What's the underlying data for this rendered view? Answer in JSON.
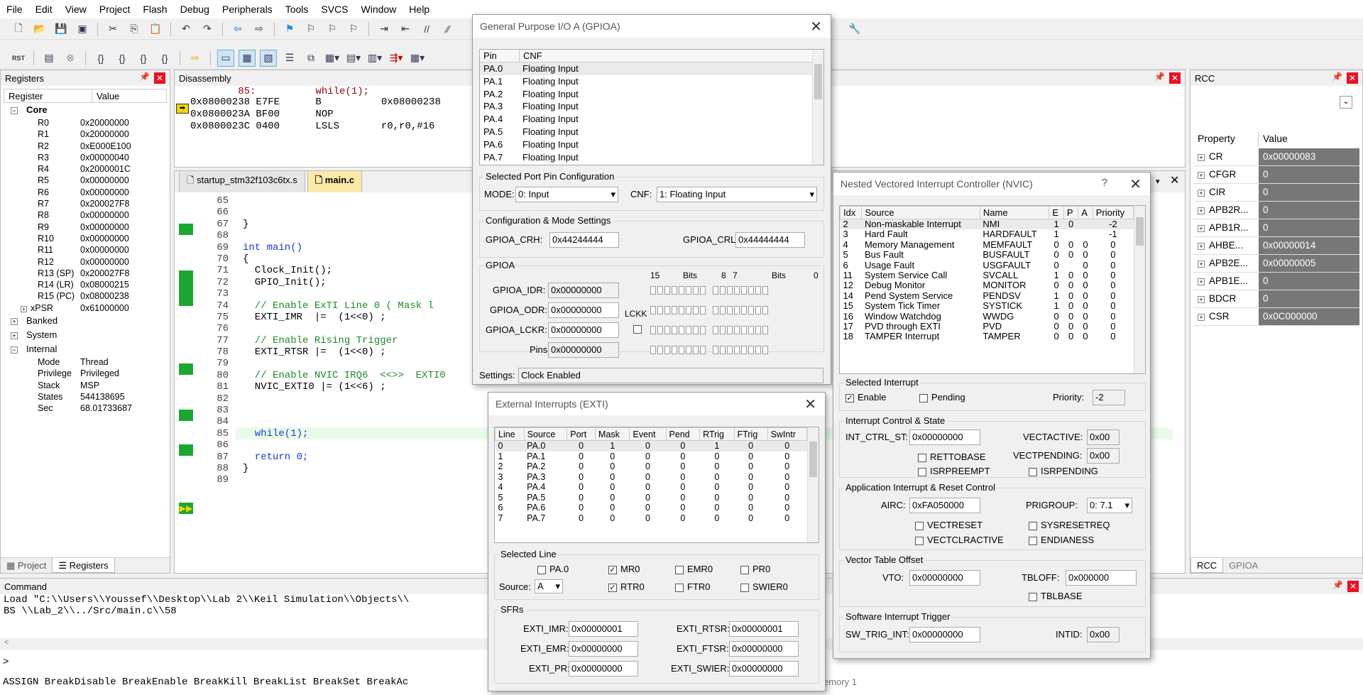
{
  "menu": [
    "File",
    "Edit",
    "View",
    "Project",
    "Flash",
    "Debug",
    "Peripherals",
    "Tools",
    "SVCS",
    "Window",
    "Help"
  ],
  "registers_panel": {
    "title": "Registers",
    "col_register": "Register",
    "col_value": "Value",
    "core_label": "Core",
    "rows": [
      [
        "R0",
        "0x20000000"
      ],
      [
        "R1",
        "0x20000000"
      ],
      [
        "R2",
        "0xE000E100"
      ],
      [
        "R3",
        "0x00000040"
      ],
      [
        "R4",
        "0x2000001C"
      ],
      [
        "R5",
        "0x00000000"
      ],
      [
        "R6",
        "0x00000000"
      ],
      [
        "R7",
        "0x200027F8"
      ],
      [
        "R8",
        "0x00000000"
      ],
      [
        "R9",
        "0x00000000"
      ],
      [
        "R10",
        "0x00000000"
      ],
      [
        "R11",
        "0x00000000"
      ],
      [
        "R12",
        "0x00000000"
      ],
      [
        "R13 (SP)",
        "0x200027F8"
      ],
      [
        "R14 (LR)",
        "0x08000215"
      ],
      [
        "R15 (PC)",
        "0x08000238"
      ],
      [
        "xPSR",
        "0x61000000"
      ]
    ],
    "banked": "Banked",
    "system": "System",
    "internal": "Internal",
    "internal_rows": [
      [
        "Mode",
        "Thread"
      ],
      [
        "Privilege",
        "Privileged"
      ],
      [
        "Stack",
        "MSP"
      ],
      [
        "States",
        "544138695"
      ],
      [
        "Sec",
        "68.01733687"
      ]
    ],
    "tab_project": "Project",
    "tab_registers": "Registers"
  },
  "disassembly": {
    "title": "Disassembly",
    "lines": [
      "        85:          while(1);",
      "0x08000238 E7FE      B          0x08000238",
      "0x0800023A BF00      NOP",
      "0x0800023C 0400      LSLS       r0,r0,#16"
    ]
  },
  "editor": {
    "tabs": [
      "startup_stm32f103c6tx.s",
      "main.c"
    ],
    "line_numbers": [
      "65",
      "66",
      "67",
      "68",
      "69",
      "70",
      "71",
      "72",
      "73",
      "74",
      "75",
      "76",
      "77",
      "78",
      "79",
      "80",
      "81",
      "82",
      "83",
      "84",
      "85",
      "86",
      "87",
      "88",
      "89"
    ],
    "code": [
      "",
      "",
      "}",
      "",
      "int main()",
      "{",
      "  Clock_Init();",
      "  GPIO_Init();",
      "",
      "  // Enable ExTI Line 0 ( Mask l",
      "  EXTI_IMR  |=  (1<<0) ;",
      "",
      "  // Enable Rising Trigger",
      "  EXTI_RTSR |=  (1<<0) ;",
      "",
      "  // Enable NVIC IRQ6  <<>>  EXTI0",
      "  NVIC_EXTI0 |= (1<<6) ;",
      "",
      "",
      "",
      "  while(1);",
      "",
      "  return 0;",
      "}",
      ""
    ]
  },
  "command": {
    "title": "Command",
    "lines": [
      "Load \"C:\\\\Users\\\\Youssef\\\\Desktop\\\\Lab 2\\\\Keil Simulation\\\\Objects\\\\",
      "BS \\\\Lab_2\\\\../Src/main.c\\\\58"
    ],
    "prompt": ">",
    "bottom": "ASSIGN BreakDisable BreakEnable BreakKill BreakList BreakSet BreakAc",
    "memory_tab": "emory 1"
  },
  "rcc": {
    "title": "RCC",
    "col_property": "Property",
    "col_value": "Value",
    "rows": [
      [
        "CR",
        "0x00000083"
      ],
      [
        "CFGR",
        "0"
      ],
      [
        "CIR",
        "0"
      ],
      [
        "APB2R...",
        "0"
      ],
      [
        "APB1R...",
        "0"
      ],
      [
        "AHBE...",
        "0x00000014"
      ],
      [
        "APB2E...",
        "0x00000005"
      ],
      [
        "APB1E...",
        "0"
      ],
      [
        "BDCR",
        "0"
      ],
      [
        "CSR",
        "0x0C000000"
      ]
    ],
    "tab_rcc": "RCC",
    "tab_gpioa": "GPIOA"
  },
  "gpio": {
    "title": "General Purpose I/O A (GPIOA)",
    "col_pin": "Pin",
    "col_cnf": "CNF",
    "pins": [
      [
        "PA.0",
        "Floating Input"
      ],
      [
        "PA.1",
        "Floating Input"
      ],
      [
        "PA.2",
        "Floating Input"
      ],
      [
        "PA.3",
        "Floating Input"
      ],
      [
        "PA.4",
        "Floating Input"
      ],
      [
        "PA.5",
        "Floating Input"
      ],
      [
        "PA.6",
        "Floating Input"
      ],
      [
        "PA.7",
        "Floating Input"
      ]
    ],
    "sel_group": "Selected Port Pin Configuration",
    "mode_label": "MODE:",
    "mode_value": "0: Input",
    "cnf_label": "CNF:",
    "cnf_value": "1: Floating Input",
    "cfg_group": "Configuration & Mode Settings",
    "crh_label": "GPIOA_CRH:",
    "crh_value": "0x44244444",
    "crl_label": "GPIOA_CRL:",
    "crl_value": "0x44444444",
    "gpio_group": "GPIOA",
    "bits_15": "15",
    "bits_label": "Bits",
    "bits_8": "8",
    "bits_7": "7",
    "bits_label2": "Bits",
    "bits_0": "0",
    "idr_label": "GPIOA_IDR:",
    "idr_value": "0x00000000",
    "odr_label": "GPIOA_ODR:",
    "odr_value": "0x00000000",
    "lckk": "LCKK",
    "lckr_label": "GPIOA_LCKR:",
    "lckr_value": "0x00000000",
    "pins_label": "Pins:",
    "pins_value": "0x00000000",
    "settings_label": "Settings:",
    "settings_value": "Clock Enabled"
  },
  "exti": {
    "title": "External Interrupts (EXTI)",
    "headers": [
      "Line",
      "Source",
      "Port",
      "Mask",
      "Event",
      "Pend",
      "RTrig",
      "FTrig",
      "SwIntr"
    ],
    "rows": [
      [
        "0",
        "PA.0",
        "0",
        "1",
        "0",
        "0",
        "1",
        "0",
        "0"
      ],
      [
        "1",
        "PA.1",
        "0",
        "0",
        "0",
        "0",
        "0",
        "0",
        "0"
      ],
      [
        "2",
        "PA.2",
        "0",
        "0",
        "0",
        "0",
        "0",
        "0",
        "0"
      ],
      [
        "3",
        "PA.3",
        "0",
        "0",
        "0",
        "0",
        "0",
        "0",
        "0"
      ],
      [
        "4",
        "PA.4",
        "0",
        "0",
        "0",
        "0",
        "0",
        "0",
        "0"
      ],
      [
        "5",
        "PA.5",
        "0",
        "0",
        "0",
        "0",
        "0",
        "0",
        "0"
      ],
      [
        "6",
        "PA.6",
        "0",
        "0",
        "0",
        "0",
        "0",
        "0",
        "0"
      ],
      [
        "7",
        "PA.7",
        "0",
        "0",
        "0",
        "0",
        "0",
        "0",
        "0"
      ]
    ],
    "sel_group": "Selected Line",
    "pa0": "PA.0",
    "mr0": "MR0",
    "emr0": "EMR0",
    "pr0": "PR0",
    "source_label": "Source:",
    "source_value": "A",
    "rtr0": "RTR0",
    "ftr0": "FTR0",
    "swier0": "SWIER0",
    "sfr_group": "SFRs",
    "imr_label": "EXTI_IMR:",
    "imr_value": "0x00000001",
    "rtsr_label": "EXTI_RTSR:",
    "rtsr_value": "0x00000001",
    "emr_label": "EXTI_EMR:",
    "emr_value": "0x00000000",
    "ftsr_label": "EXTI_FTSR:",
    "ftsr_value": "0x00000000",
    "pr_label": "EXTI_PR:",
    "pr_value": "0x00000000",
    "swier_label": "EXTI_SWIER:",
    "swier_value": "0x00000000"
  },
  "nvic": {
    "title": "Nested Vectored Interrupt Controller (NVIC)",
    "help": "?",
    "headers": [
      "Idx",
      "Source",
      "Name",
      "E",
      "P",
      "A",
      "Priority"
    ],
    "rows": [
      [
        "2",
        "Non-maskable Interrupt",
        "NMI",
        "1",
        "0",
        "",
        "-2"
      ],
      [
        "3",
        "Hard Fault",
        "HARDFAULT",
        "1",
        "",
        "",
        "-1"
      ],
      [
        "4",
        "Memory Management",
        "MEMFAULT",
        "0",
        "0",
        "0",
        "0"
      ],
      [
        "5",
        "Bus Fault",
        "BUSFAULT",
        "0",
        "0",
        "0",
        "0"
      ],
      [
        "6",
        "Usage Fault",
        "USGFAULT",
        "0",
        "",
        "0",
        "0"
      ],
      [
        "11",
        "System Service Call",
        "SVCALL",
        "1",
        "0",
        "0",
        "0"
      ],
      [
        "12",
        "Debug Monitor",
        "MONITOR",
        "0",
        "0",
        "0",
        "0"
      ],
      [
        "14",
        "Pend System Service",
        "PENDSV",
        "1",
        "0",
        "0",
        "0"
      ],
      [
        "15",
        "System Tick Timer",
        "SYSTICK",
        "1",
        "0",
        "0",
        "0"
      ],
      [
        "16",
        "Window Watchdog",
        "WWDG",
        "0",
        "0",
        "0",
        "0"
      ],
      [
        "17",
        "PVD through EXTI",
        "PVD",
        "0",
        "0",
        "0",
        "0"
      ],
      [
        "18",
        "TAMPER Interrupt",
        "TAMPER",
        "0",
        "0",
        "0",
        "0"
      ]
    ],
    "sel_group": "Selected Interrupt",
    "enable": "Enable",
    "pending": "Pending",
    "priority_label": "Priority:",
    "priority_value": "-2",
    "ics_group": "Interrupt Control & State",
    "ics_label": "INT_CTRL_ST:",
    "ics_value": "0x00000000",
    "vectactive_label": "VECTACTIVE:",
    "vectactive_value": "0x00",
    "rettobase": "RETTOBASE",
    "vectpending_label": "VECTPENDING:",
    "vectpending_value": "0x00",
    "isrpreempt": "ISRPREEMPT",
    "isrpending": "ISRPENDING",
    "airc_group": "Application Interrupt & Reset Control",
    "airc_label": "AIRC:",
    "airc_value": "0xFA050000",
    "prigroup_label": "PRIGROUP:",
    "prigroup_value": "0: 7.1",
    "vectreset": "VECTRESET",
    "sysresetreq": "SYSRESETREQ",
    "vectclractive": "VECTCLRACTIVE",
    "endianess": "ENDIANESS",
    "vto_group": "Vector Table Offset",
    "vto_label": "VTO:",
    "vto_value": "0x00000000",
    "tbloff_label": "TBLOFF:",
    "tbloff_value": "0x000000",
    "tblbase": "TBLBASE",
    "swi_group": "Software Interrupt Trigger",
    "swi_label": "SW_TRIG_INT:",
    "swi_value": "0x00000000",
    "intid_label": "INTID:",
    "intid_value": "0x00"
  }
}
